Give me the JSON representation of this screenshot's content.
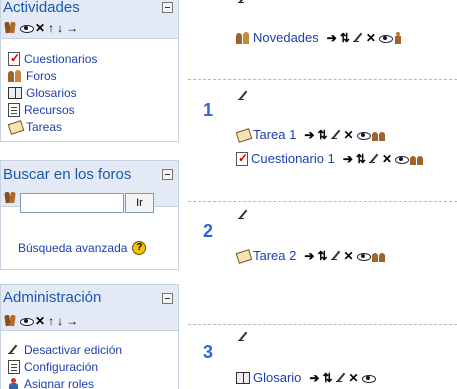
{
  "blocks": {
    "activities": {
      "title": "Actividades",
      "items": [
        {
          "label": "Cuestionarios",
          "icon": "quiz-icon"
        },
        {
          "label": "Foros",
          "icon": "forum-icon"
        },
        {
          "label": "Glosarios",
          "icon": "glossary-icon"
        },
        {
          "label": "Recursos",
          "icon": "resource-icon"
        },
        {
          "label": "Tareas",
          "icon": "assignment-icon"
        }
      ]
    },
    "search": {
      "title": "Buscar en los foros",
      "button_label": "Ir",
      "input_value": "",
      "advanced_link": "Búsqueda avanzada"
    },
    "admin": {
      "title": "Administración",
      "items": [
        {
          "label": "Desactivar edición",
          "icon": "pencil-icon"
        },
        {
          "label": "Configuración",
          "icon": "settings-icon"
        },
        {
          "label": "Asignar roles",
          "icon": "roles-icon"
        }
      ]
    }
  },
  "block_tools_icons": [
    "hands-icon",
    "eye-icon",
    "delete-icon",
    "move-up-icon",
    "move-down-icon",
    "move-right-icon"
  ],
  "activity_tools_icons": [
    "indent-icon",
    "move-icon",
    "edit-icon",
    "delete-icon",
    "eye-icon",
    "group-mode-icon"
  ],
  "sections": [
    {
      "number": "",
      "activities": [
        {
          "label": "Novedades",
          "icon": "forum-icon"
        }
      ]
    },
    {
      "number": "1",
      "activities": [
        {
          "label": "Tarea 1",
          "icon": "assignment-icon"
        },
        {
          "label": "Cuestionario 1",
          "icon": "quiz-icon"
        }
      ]
    },
    {
      "number": "2",
      "activities": [
        {
          "label": "Tarea 2",
          "icon": "assignment-icon"
        }
      ]
    },
    {
      "number": "3",
      "activities": [
        {
          "label": "Glosario",
          "icon": "glossary-icon"
        }
      ]
    }
  ],
  "colors": {
    "block_header_bg": "#e3eaf5",
    "block_title": "#1d58b0",
    "link": "#1d3fb0",
    "section_number": "#3366cc"
  }
}
